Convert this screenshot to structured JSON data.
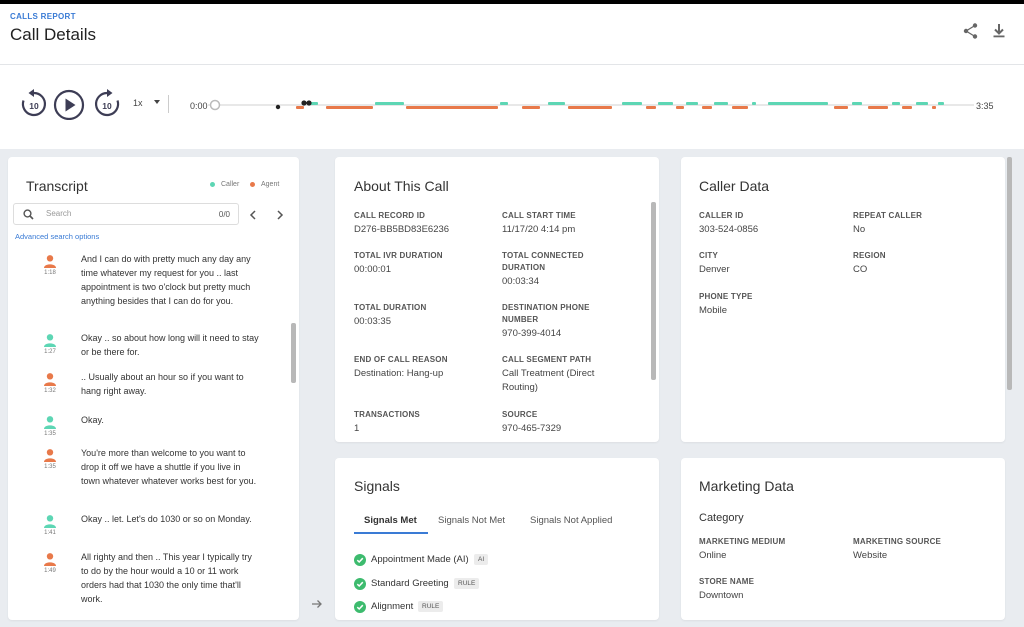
{
  "header": {
    "breadcrumb": "CALLS REPORT",
    "title": "Call Details",
    "icons": [
      "share-icon",
      "download-icon"
    ]
  },
  "player": {
    "speed": "1x",
    "start_time": "0:00",
    "end_time": "3:35",
    "colors": {
      "caller": "#5dd6b4",
      "agent": "#e8794a"
    }
  },
  "transcript": {
    "title": "Transcript",
    "legend": {
      "caller": "Caller",
      "agent": "Agent"
    },
    "search_placeholder": "Search",
    "search_count": "0/0",
    "advanced_link": "Advanced search options",
    "items": [
      {
        "speaker": "agent",
        "time": "1:18",
        "text": "And I can do with pretty much any day any time whatever my request for you .. last appointment is two o'clock but pretty much anything besides that I can do for you."
      },
      {
        "speaker": "caller",
        "time": "1:27",
        "text": "Okay .. so about how long will it need to stay or be there for."
      },
      {
        "speaker": "agent",
        "time": "1:32",
        "text": ".. Usually about an hour so if you want to hang right away."
      },
      {
        "speaker": "caller",
        "time": "1:35",
        "text": "Okay."
      },
      {
        "speaker": "agent",
        "time": "1:35",
        "text": "You're more than welcome to you want to drop it off we have a shuttle if you live in town whatever whatever works best for you."
      },
      {
        "speaker": "caller",
        "time": "1:41",
        "text": "Okay .. let. Let's do 1030 or so on Monday."
      },
      {
        "speaker": "agent",
        "time": "1:49",
        "text": "All righty and then .. This year I typically try to do by the hour would a 10 or 11 work orders had that 1030 the only time that'll work."
      }
    ]
  },
  "about": {
    "title": "About This Call",
    "fields": [
      {
        "label": "CALL RECORD ID",
        "value": "D276-BB5BD83E6236"
      },
      {
        "label": "CALL START TIME",
        "value": "11/17/20 4:14 pm"
      },
      {
        "label": "TOTAL IVR DURATION",
        "value": "00:00:01"
      },
      {
        "label": "TOTAL CONNECTED DURATION",
        "value": "00:03:34"
      },
      {
        "label": "TOTAL DURATION",
        "value": "00:03:35"
      },
      {
        "label": "DESTINATION PHONE NUMBER",
        "value": "970-399-4014"
      },
      {
        "label": "END OF CALL REASON",
        "value": "Destination: Hang-up"
      },
      {
        "label": "CALL SEGMENT PATH",
        "value": "Call Treatment (Direct Routing)"
      },
      {
        "label": "TRANSACTIONS",
        "value": "1"
      },
      {
        "label": "SOURCE",
        "value": "970-465-7329"
      }
    ]
  },
  "caller_data": {
    "title": "Caller Data",
    "fields": [
      {
        "label": "CALLER ID",
        "value": "303-524-0856"
      },
      {
        "label": "REPEAT CALLER",
        "value": "No"
      },
      {
        "label": "CITY",
        "value": "Denver"
      },
      {
        "label": "REGION",
        "value": "CO"
      },
      {
        "label": "PHONE TYPE",
        "value": "Mobile"
      }
    ]
  },
  "signals": {
    "title": "Signals",
    "tabs": [
      "Signals Met",
      "Signals Not Met",
      "Signals Not Applied"
    ],
    "active_tab": "Signals Met",
    "items": [
      {
        "text": "Appointment Made (AI)",
        "tag": "AI"
      },
      {
        "text": "Standard Greeting",
        "tag": "RULE"
      },
      {
        "text": "Alignment",
        "tag": "RULE"
      }
    ],
    "check_color": "#3dbb6e"
  },
  "marketing": {
    "title": "Marketing Data",
    "category": "Category",
    "fields": [
      {
        "label": "MARKETING MEDIUM",
        "value": "Online"
      },
      {
        "label": "MARKETING SOURCE",
        "value": "Website"
      },
      {
        "label": "STORE NAME",
        "value": "Downtown"
      }
    ]
  }
}
